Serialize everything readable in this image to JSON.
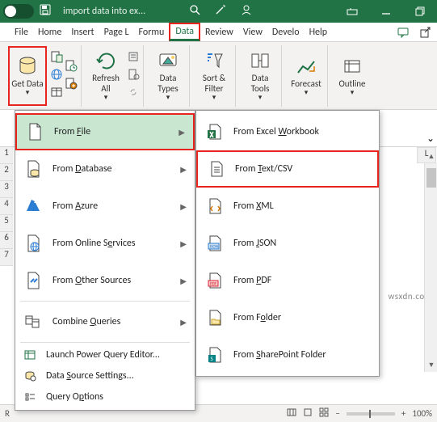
{
  "titlebar": {
    "title": "import data into ex..."
  },
  "menubar": {
    "items": [
      "File",
      "Home",
      "Insert",
      "Page L",
      "Formu",
      "Data",
      "Review",
      "View",
      "Develo",
      "Help"
    ],
    "active_index": 5
  },
  "ribbon": {
    "get_data": "Get Data",
    "refresh": "Refresh All",
    "data_types": "Data Types",
    "sort_filter": "Sort & Filter",
    "data_tools": "Data Tools",
    "forecast": "Forecast",
    "outline": "Outline"
  },
  "menu1": {
    "items": [
      {
        "label": "From File",
        "arrow": true,
        "hl": true
      },
      {
        "label": "From Database",
        "arrow": true
      },
      {
        "label": "From Azure",
        "arrow": true
      },
      {
        "label": "From Online Services",
        "arrow": true
      },
      {
        "label": "From Other Sources",
        "arrow": true
      },
      {
        "label": "Combine Queries",
        "arrow": true
      },
      {
        "label": "Launch Power Query Editor...",
        "small": true
      },
      {
        "label": "Data Source Settings...",
        "small": true
      },
      {
        "label": "Query Options",
        "small": true
      }
    ]
  },
  "menu2": {
    "items": [
      {
        "label": "From Excel Workbook"
      },
      {
        "label": "From Text/CSV",
        "hl": true
      },
      {
        "label": "From XML"
      },
      {
        "label": "From JSON"
      },
      {
        "label": "From PDF"
      },
      {
        "label": "From Folder"
      },
      {
        "label": "From SharePoint Folder"
      }
    ]
  },
  "status": {
    "ready": "R",
    "zoom": "100%",
    "minus": "−",
    "plus": "+"
  },
  "row_headers": [
    "1",
    "2",
    "3",
    "4",
    "5",
    "6",
    "7"
  ],
  "col_header": "L",
  "formula": {
    "name": "",
    "entry": ""
  },
  "watermark": "wsxdn.com"
}
